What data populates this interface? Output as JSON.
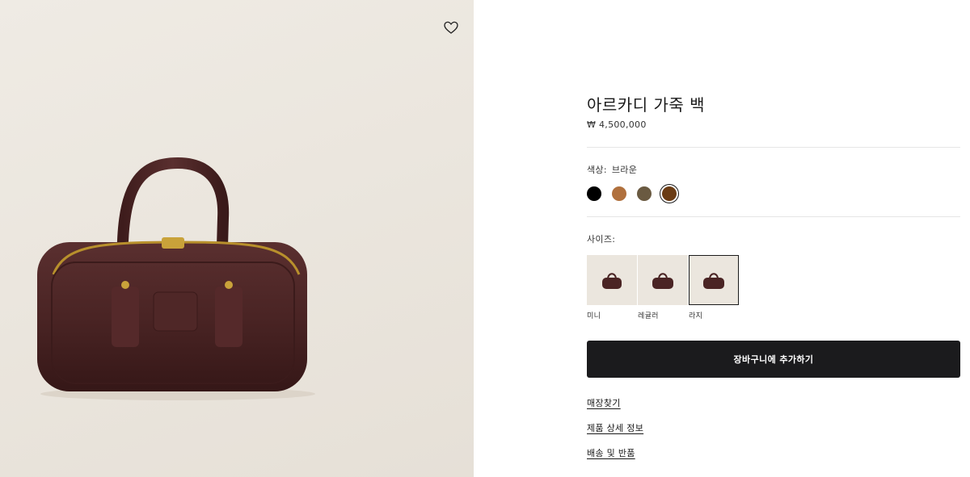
{
  "product": {
    "title": "아르카디 가죽 백",
    "price": "₩ 4,500,000"
  },
  "color": {
    "label": "색상:",
    "selected": "브라운",
    "swatches": [
      {
        "name": "black",
        "hex": "#000000"
      },
      {
        "name": "cognac",
        "hex": "#b0703d"
      },
      {
        "name": "olive",
        "hex": "#6a5a41"
      },
      {
        "name": "brown",
        "hex": "#6b3c14",
        "selected": true
      }
    ]
  },
  "size": {
    "label": "사이즈:",
    "options": [
      {
        "label": "미니"
      },
      {
        "label": "레귤러"
      },
      {
        "label": "라지",
        "selected": true
      }
    ]
  },
  "cart": {
    "button_label": "장바구니에 추가하기"
  },
  "links": {
    "store_finder": "매장찾기",
    "product_details": "제품 상세 정보",
    "shipping_returns": "배송 및 반품"
  },
  "icons": {
    "wishlist": "heart-icon"
  },
  "colors": {
    "button_bg": "#1b1b1d",
    "bag": "#4a2626"
  }
}
